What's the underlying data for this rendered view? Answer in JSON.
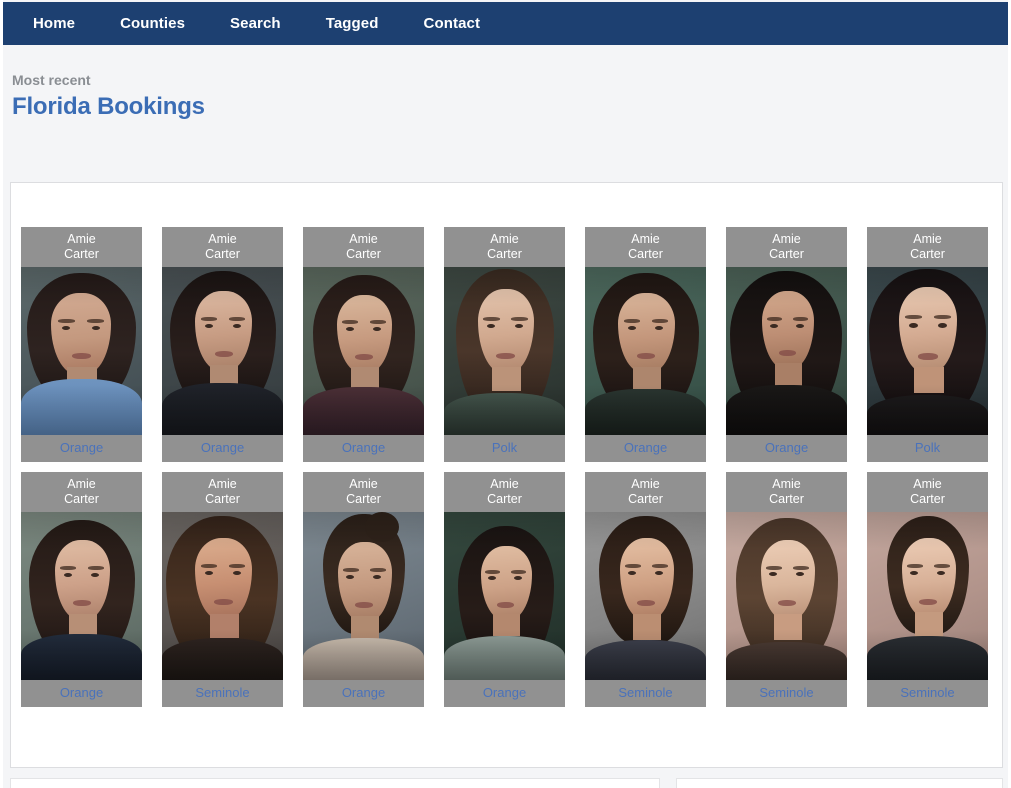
{
  "nav": {
    "items": [
      {
        "label": "Home",
        "name": "nav-item-home"
      },
      {
        "label": "Counties",
        "name": "nav-item-counties"
      },
      {
        "label": "Search",
        "name": "nav-item-search"
      },
      {
        "label": "Tagged",
        "name": "nav-item-tagged"
      },
      {
        "label": "Contact",
        "name": "nav-item-contact"
      }
    ]
  },
  "header": {
    "kicker": "Most recent",
    "title": "Florida Bookings"
  },
  "colors": {
    "nav_bg": "#1d4071",
    "page_bg": "#f4f5f7",
    "panel_bg": "#ffffff",
    "card_band": "#919191",
    "card_name_text": "#ffffff",
    "county_link": "#4a72bb",
    "title_text": "#3b6db5",
    "kicker_text": "#8a8e93"
  },
  "results": {
    "rows": [
      {
        "cards": [
          {
            "name": "Amie\nCarter",
            "county": "Orange"
          },
          {
            "name": "Amie\nCarter",
            "county": "Orange"
          },
          {
            "name": "Amie\nCarter",
            "county": "Orange"
          },
          {
            "name": "Amie\nCarter",
            "county": "Polk"
          },
          {
            "name": "Amie\nCarter",
            "county": "Orange"
          },
          {
            "name": "Amie\nCarter",
            "county": "Orange"
          },
          {
            "name": "Amie\nCarter",
            "county": "Polk"
          }
        ]
      },
      {
        "cards": [
          {
            "name": "Amie\nCarter",
            "county": "Orange"
          },
          {
            "name": "Amie\nCarter",
            "county": "Seminole"
          },
          {
            "name": "Amie\nCarter",
            "county": "Orange"
          },
          {
            "name": "Amie\nCarter",
            "county": "Orange"
          },
          {
            "name": "Amie\nCarter",
            "county": "Seminole"
          },
          {
            "name": "Amie\nCarter",
            "county": "Seminole"
          },
          {
            "name": "Amie\nCarter",
            "county": "Seminole"
          }
        ]
      }
    ]
  }
}
